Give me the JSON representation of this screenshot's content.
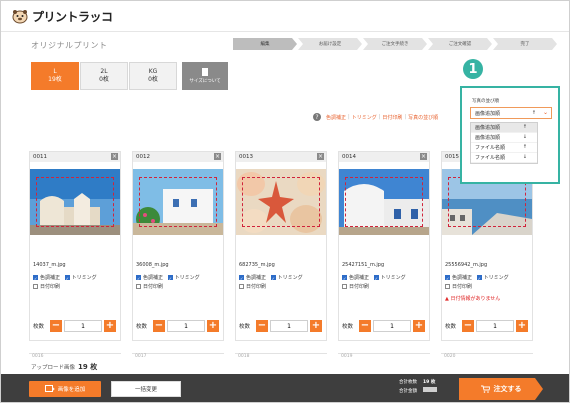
{
  "brand": {
    "name": "プリントラッコ"
  },
  "page": {
    "title": "オリジナルプリント"
  },
  "steps": [
    "編集",
    "お届け設定",
    "ご注文手続き",
    "ご注文確認",
    "完了"
  ],
  "sizes": [
    {
      "name": "L",
      "count": "19枚",
      "active": true
    },
    {
      "name": "2L",
      "count": "0枚",
      "active": false
    },
    {
      "name": "KG",
      "count": "0枚",
      "active": false
    }
  ],
  "size_about": "サイズについて",
  "hints": [
    "色調補正",
    "トリミング",
    "日付印刷",
    "写真の並び順"
  ],
  "sort": {
    "label": "写真の並び順",
    "selected": "画像追加順",
    "selected_arrow": "↑",
    "options": [
      {
        "label": "画像追加順",
        "arrow": "↑"
      },
      {
        "label": "画像追加順",
        "arrow": "↓"
      },
      {
        "label": "ファイル名順",
        "arrow": "↑"
      },
      {
        "label": "ファイル名順",
        "arrow": "↓"
      }
    ]
  },
  "annotation_badge": "1",
  "photos": [
    {
      "id": "0011",
      "filename": "14037_m.jpg",
      "color_correction": "色調補正",
      "trimming": "トリミング",
      "date_print": "日付印刷",
      "qty_label": "枚数",
      "qty": "1",
      "warning": ""
    },
    {
      "id": "0012",
      "filename": "36008_m.jpg",
      "color_correction": "色調補正",
      "trimming": "トリミング",
      "date_print": "日付印刷",
      "qty_label": "枚数",
      "qty": "1",
      "warning": ""
    },
    {
      "id": "0013",
      "filename": "682735_m.jpg",
      "color_correction": "色調補正",
      "trimming": "トリミング",
      "date_print": "日付印刷",
      "qty_label": "枚数",
      "qty": "1",
      "warning": ""
    },
    {
      "id": "0014",
      "filename": "25427151_m.jpg",
      "color_correction": "色調補正",
      "trimming": "トリミング",
      "date_print": "日付印刷",
      "qty_label": "枚数",
      "qty": "1",
      "warning": ""
    },
    {
      "id": "0015",
      "filename": "25556942_m.jpg",
      "color_correction": "色調補正",
      "trimming": "トリミング",
      "date_print": "日付印刷",
      "qty_label": "枚数",
      "qty": "1",
      "warning": "日付情報がありません"
    }
  ],
  "next_row_ids": [
    "0016",
    "0017",
    "0018",
    "0019",
    "0020"
  ],
  "upload": {
    "label": "アップロード画像",
    "count": "19 枚"
  },
  "footer": {
    "add_images": "画像を追加",
    "bulk_change": "一括変更",
    "total_count_label": "合計枚数",
    "total_count": "19 枚",
    "total_price_label": "合計金額",
    "order_button": "注文する"
  },
  "colors": {
    "accent": "#f47b2a",
    "highlight": "#36b3a3",
    "warning": "#e02a2a",
    "footer_bg": "#3e3e3e"
  }
}
